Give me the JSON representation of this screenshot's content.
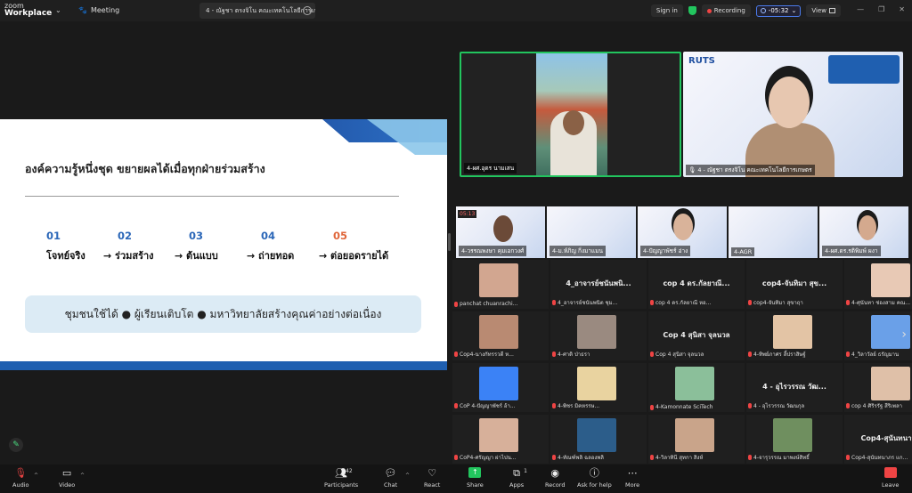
{
  "titlebar": {
    "brand_line1": "zoom",
    "brand_line2": "Workplace",
    "meeting_label": "Meeting",
    "tab_label": "4 - ณัฐชา ตรงจิโน คณะเทคโนโลยีการเกษตร",
    "sign_in": "Sign in",
    "recording": "Recording",
    "timer": "-05:32",
    "view": "View"
  },
  "slide": {
    "title": "องค์ความรู้หนึ่งชุด ขยายผลได้เมื่อทุกฝ่ายร่วมสร้าง",
    "steps": [
      {
        "num": "01",
        "label": "โจทย์จริง"
      },
      {
        "num": "02",
        "label": "→ ร่วมสร้าง"
      },
      {
        "num": "03",
        "label": "→ ต้นแบบ"
      },
      {
        "num": "04",
        "label": "→ ถ่ายทอด"
      },
      {
        "num": "05",
        "label": "→ ต่อยอดรายได้"
      }
    ],
    "summary": "ชุมชนใช้ได้ ● ผู้เรียนเติบโต ● มหาวิทยาลัยสร้างคุณค่าอย่างต่อเนื่อง"
  },
  "speakers": [
    {
      "name": "4-ผศ.อุดร นามเสน"
    },
    {
      "name": "4 - ณัฐชา ตรงจิโน คณะเทคโนโลยีการเกษตร"
    }
  ],
  "strip": [
    {
      "name": "4-วรรณพงษา คุมเอกวงศ์"
    },
    {
      "name": "4-ม.ห์ภิญ กิ่งมาแมน"
    },
    {
      "name": "4-ปัญญาพัชร์ อ่าง"
    },
    {
      "name": "4-AGR"
    },
    {
      "name": "4-ผศ.ดร.รติพิมพ์ ผงา"
    }
  ],
  "grid": [
    {
      "center": "",
      "tag": "panchat chuanrachi..."
    },
    {
      "center": "4_อาจารย์ชนันพนิ...",
      "tag": "4_อาจารย์ชนันพนิต ชุม..."
    },
    {
      "center": "cop 4 ดร.กัลยาณี...",
      "tag": "cop 4 ดร.กัลยาณี หอ..."
    },
    {
      "center": "cop4-จันทิมา สุข...",
      "tag": "cop4-จันทิมา สุขาฤา"
    },
    {
      "center": "",
      "tag": "4-ศุนันทา ช่องสาม คณ..."
    },
    {
      "center": "",
      "tag": "Cop4-นางกัทรรวดี ห..."
    },
    {
      "center": "",
      "tag": "4-ศาติ ป่าธรา"
    },
    {
      "center": "Cop 4 สุนิสา จุลนวล",
      "tag": "Cop 4 สุนิสา จุลนวล"
    },
    {
      "center": "",
      "tag": "4-ทิพย์ภาศร ลี้ปราสิษฐ์"
    },
    {
      "center": "",
      "tag": "4_วิลาวัลย์ ธรัญมาน"
    },
    {
      "center": "",
      "tag": "CoP 4-ปัญญาพัชร์ อ้า..."
    },
    {
      "center": "",
      "tag": "4-พิชร มิคหรรษ..."
    },
    {
      "center": "",
      "tag": "4-Kamonnate SciTech"
    },
    {
      "center": "4 - อุไรวรรณ วัฒ...",
      "tag": "4 - อุไรวรรณ วัฒนกุล"
    },
    {
      "center": "",
      "tag": "cop 4 ศิริรรัฐ สีริเพลา"
    },
    {
      "center": "",
      "tag": "CoP4-ศรัญญา ผ่าไปน..."
    },
    {
      "center": "",
      "tag": "4-ทัณฑ์พลิ ฉลองพลิ"
    },
    {
      "center": "",
      "tag": "4-วิลาทินี สุทกา สิงห์"
    },
    {
      "center": "",
      "tag": "4-จารุวรรณ มาพงษ์สิทธิ์"
    },
    {
      "center": "Cop4-สุนันทนาก...",
      "tag": "Cop4-สุนันทนาภร แก..."
    }
  ],
  "toolbar": {
    "audio": "Audio",
    "video": "Video",
    "participants": "Participants",
    "participants_count": "42",
    "chat": "Chat",
    "react": "React",
    "share": "Share",
    "apps": "Apps",
    "apps_count": "1",
    "record": "Record",
    "help": "Ask for help",
    "more": "More",
    "leave": "Leave"
  },
  "colors": {
    "accent_green": "#22c55e",
    "slide_blue": "#2b67b8",
    "step5_orange": "#e0663a",
    "leave_red": "#ef4444"
  }
}
